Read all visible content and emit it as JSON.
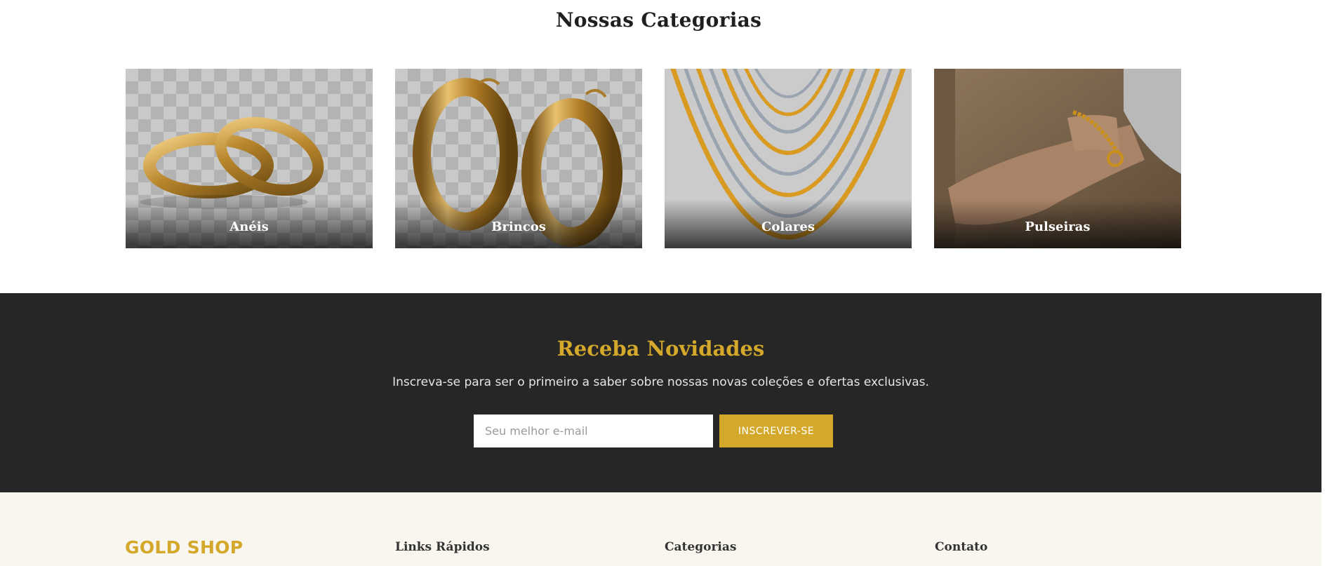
{
  "categories": {
    "title": "Nossas Categorias",
    "items": [
      {
        "label": "Anéis"
      },
      {
        "label": "Brincos"
      },
      {
        "label": "Colares"
      },
      {
        "label": "Pulseiras"
      }
    ]
  },
  "newsletter": {
    "title": "Receba Novidades",
    "text": "Inscreva-se para ser o primeiro a saber sobre nossas novas coleções e ofertas exclusivas.",
    "email_placeholder": "Seu melhor e-mail",
    "button_label": "INSCREVER-SE"
  },
  "footer": {
    "logo": "GOLD SHOP",
    "columns": [
      {
        "heading": "Links Rápidos"
      },
      {
        "heading": "Categorias"
      },
      {
        "heading": "Contato"
      }
    ]
  },
  "colors": {
    "accent": "#d4a82a",
    "dark_section": "#262626",
    "footer_bg": "#f8f6ef"
  }
}
